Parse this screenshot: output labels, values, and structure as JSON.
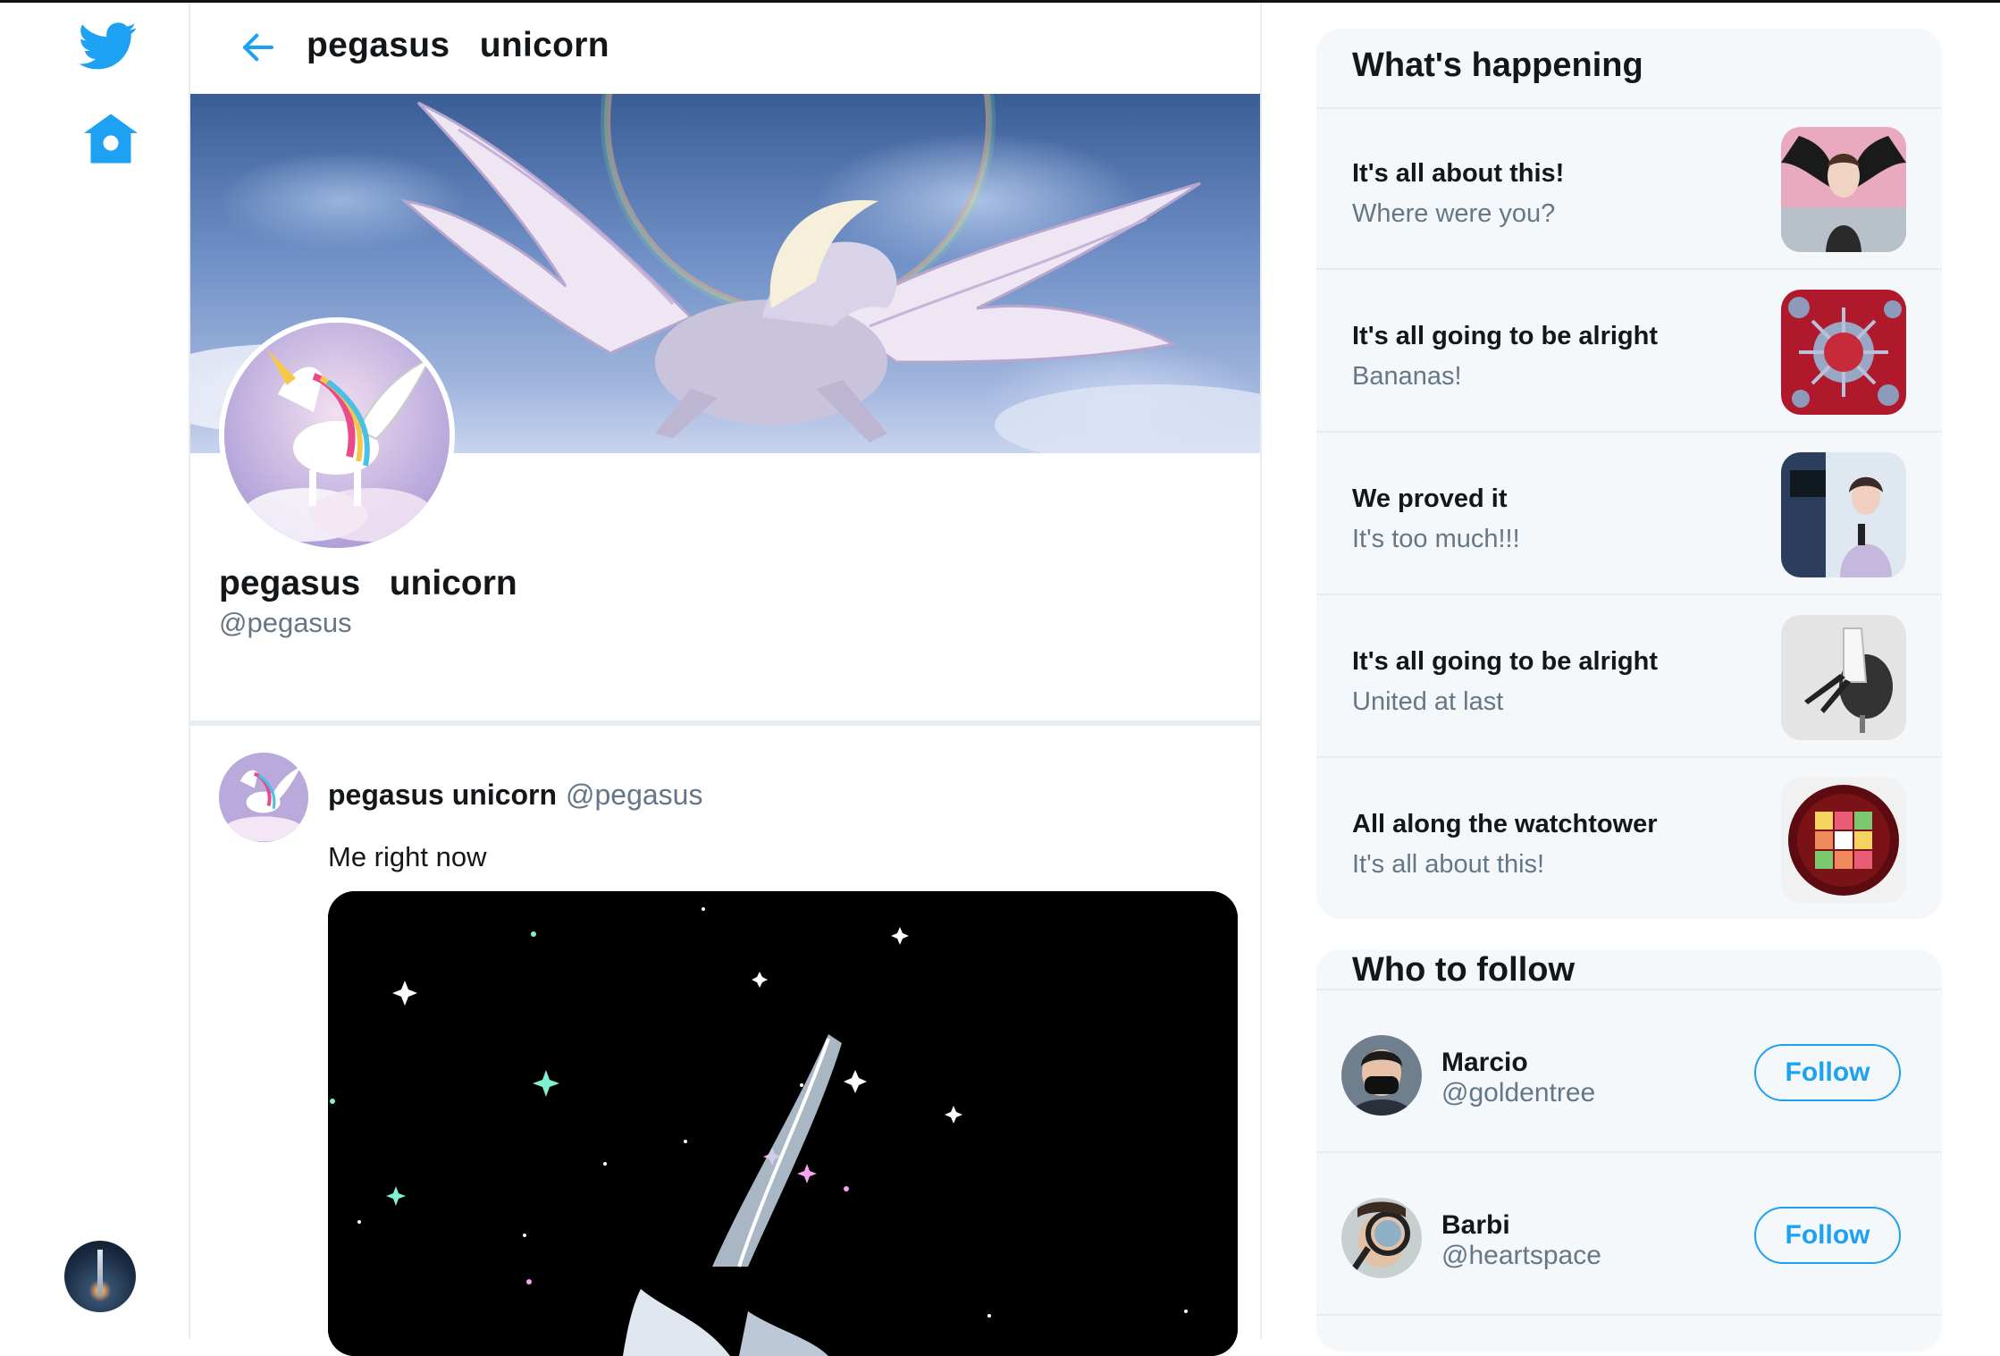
{
  "app": {
    "brand_color": "#1da1f2",
    "nav": {
      "logo_icon": "twitter-bird-icon",
      "home_icon": "home-icon"
    }
  },
  "header": {
    "title": "pegasus   unicorn",
    "back_icon": "back-arrow-icon"
  },
  "profile": {
    "name": "pegasus   unicorn",
    "handle": "@pegasus"
  },
  "tweet": {
    "author": "pegasus unicorn",
    "handle": "@pegasus",
    "text": "Me right now"
  },
  "trends": {
    "title": "What's happening",
    "items": [
      {
        "title": "It's all about this!",
        "subtitle": "Where were you?"
      },
      {
        "title": "It's all going to be alright",
        "subtitle": "Bananas!"
      },
      {
        "title": "We proved it",
        "subtitle": "It's too much!!!"
      },
      {
        "title": "It's all going to be alright",
        "subtitle": "United at last"
      },
      {
        "title": "All along the watchtower",
        "subtitle": "It's all about this!"
      }
    ]
  },
  "who_to_follow": {
    "title": "Who to follow",
    "users": [
      {
        "name": "Marcio",
        "handle": "@goldentree",
        "button": "Follow"
      },
      {
        "name": "Barbi",
        "handle": "@heartspace",
        "button": "Follow"
      }
    ]
  }
}
